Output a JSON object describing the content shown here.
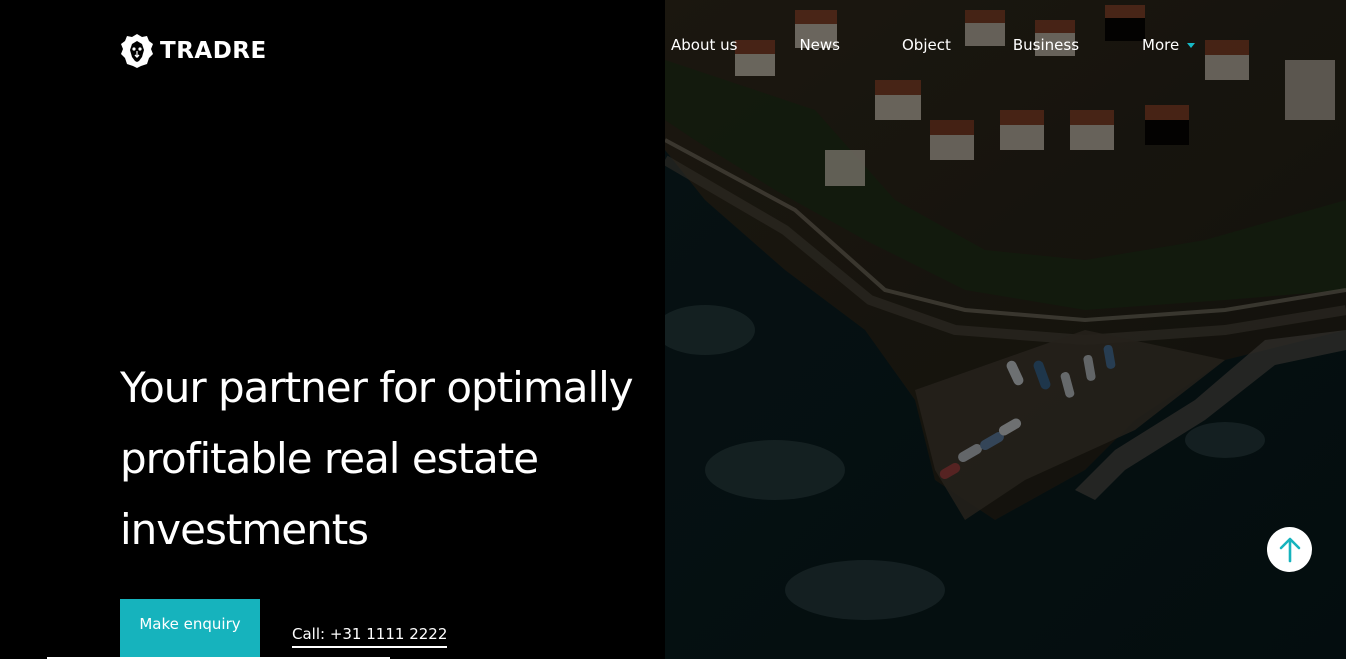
{
  "brand": {
    "name": "TRADRE",
    "logo_icon": "lion-head-icon"
  },
  "nav": {
    "items": [
      {
        "label": "About us"
      },
      {
        "label": "News"
      },
      {
        "label": "Object"
      },
      {
        "label": "Business"
      },
      {
        "label": "More",
        "has_dropdown": true
      }
    ]
  },
  "hero": {
    "headline_lines": [
      "Your partner for optimally",
      "profitable real estate",
      "investments"
    ],
    "image": "aerial-coastal-village-photo",
    "primary_button": "Make enquiry",
    "call_link": "Call: +31 1111 2222"
  },
  "scroll_top": {
    "icon": "arrow-up-icon"
  },
  "colors": {
    "accent": "#16b3bd",
    "background": "#000000",
    "text": "#ffffff"
  }
}
